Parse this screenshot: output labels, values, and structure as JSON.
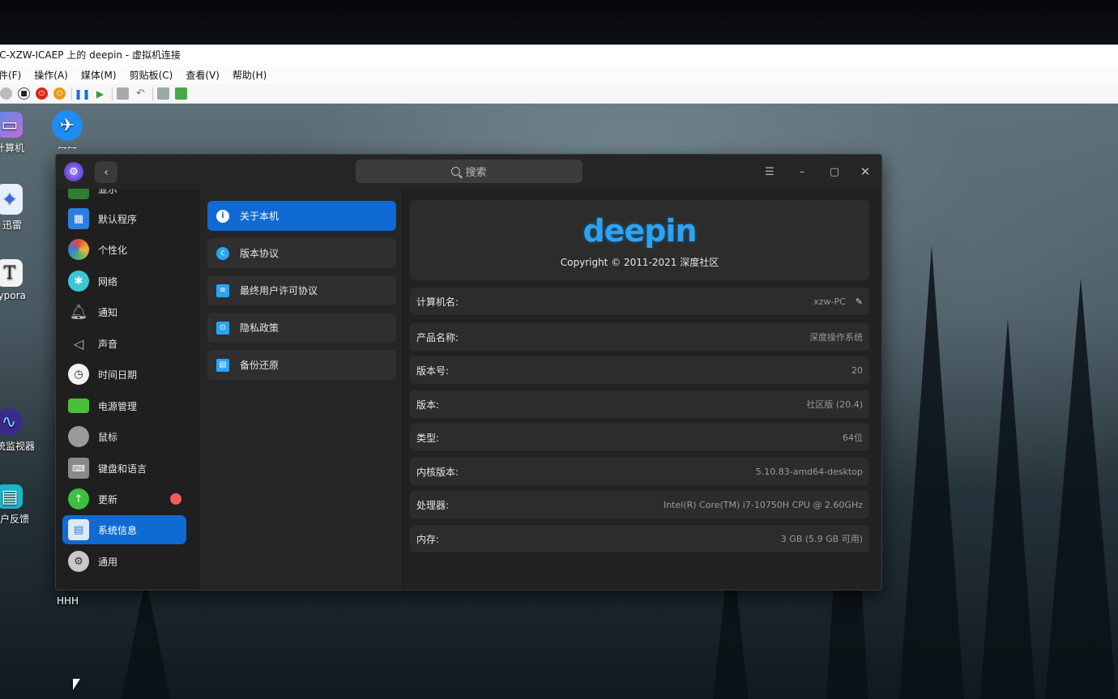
{
  "vm": {
    "title": "PC-XZW-ICAEP 上的 deepin - 虚拟机连接",
    "menu": [
      "文件(F)",
      "操作(A)",
      "媒体(M)",
      "剪贴板(C)",
      "查看(V)",
      "帮助(H)"
    ]
  },
  "desktop": {
    "icons": [
      "计算机",
      "钉钉",
      "迅雷",
      "Typora",
      "系统监视器",
      "用户反馈"
    ],
    "bottom_label": "HHH"
  },
  "window": {
    "search_placeholder": "搜索",
    "sidebar": [
      {
        "label": "显示"
      },
      {
        "label": "默认程序"
      },
      {
        "label": "个性化"
      },
      {
        "label": "网络"
      },
      {
        "label": "通知"
      },
      {
        "label": "声音"
      },
      {
        "label": "时间日期"
      },
      {
        "label": "电源管理"
      },
      {
        "label": "鼠标"
      },
      {
        "label": "键盘和语言"
      },
      {
        "label": "更新"
      },
      {
        "label": "系统信息"
      },
      {
        "label": "通用"
      }
    ],
    "middle": [
      {
        "label": "关于本机"
      },
      {
        "label": "版本协议"
      },
      {
        "label": "最终用户许可协议"
      },
      {
        "label": "隐私政策"
      },
      {
        "label": "备份还原"
      }
    ],
    "about": {
      "logo": "deepin",
      "copyright": "Copyright © 2011-2021 深度社区",
      "rows": [
        {
          "label": "计算机名:",
          "value": "xzw-PC"
        },
        {
          "label": "产品名称:",
          "value": "深度操作系统"
        },
        {
          "label": "版本号:",
          "value": "20"
        },
        {
          "label": "版本:",
          "value": "社区版 (20.4)"
        },
        {
          "label": "类型:",
          "value": "64位"
        },
        {
          "label": "内核版本:",
          "value": "5.10.83-amd64-desktop"
        },
        {
          "label": "处理器:",
          "value": "Intel(R) Core(TM) i7-10750H CPU @ 2.60GHz"
        },
        {
          "label": "内存:",
          "value": "3 GB (5.9 GB 可用)"
        }
      ]
    }
  },
  "colors": {
    "accent": "#0f6ad3",
    "logo": "#2aa4f4",
    "badge": "#f35b5b"
  }
}
